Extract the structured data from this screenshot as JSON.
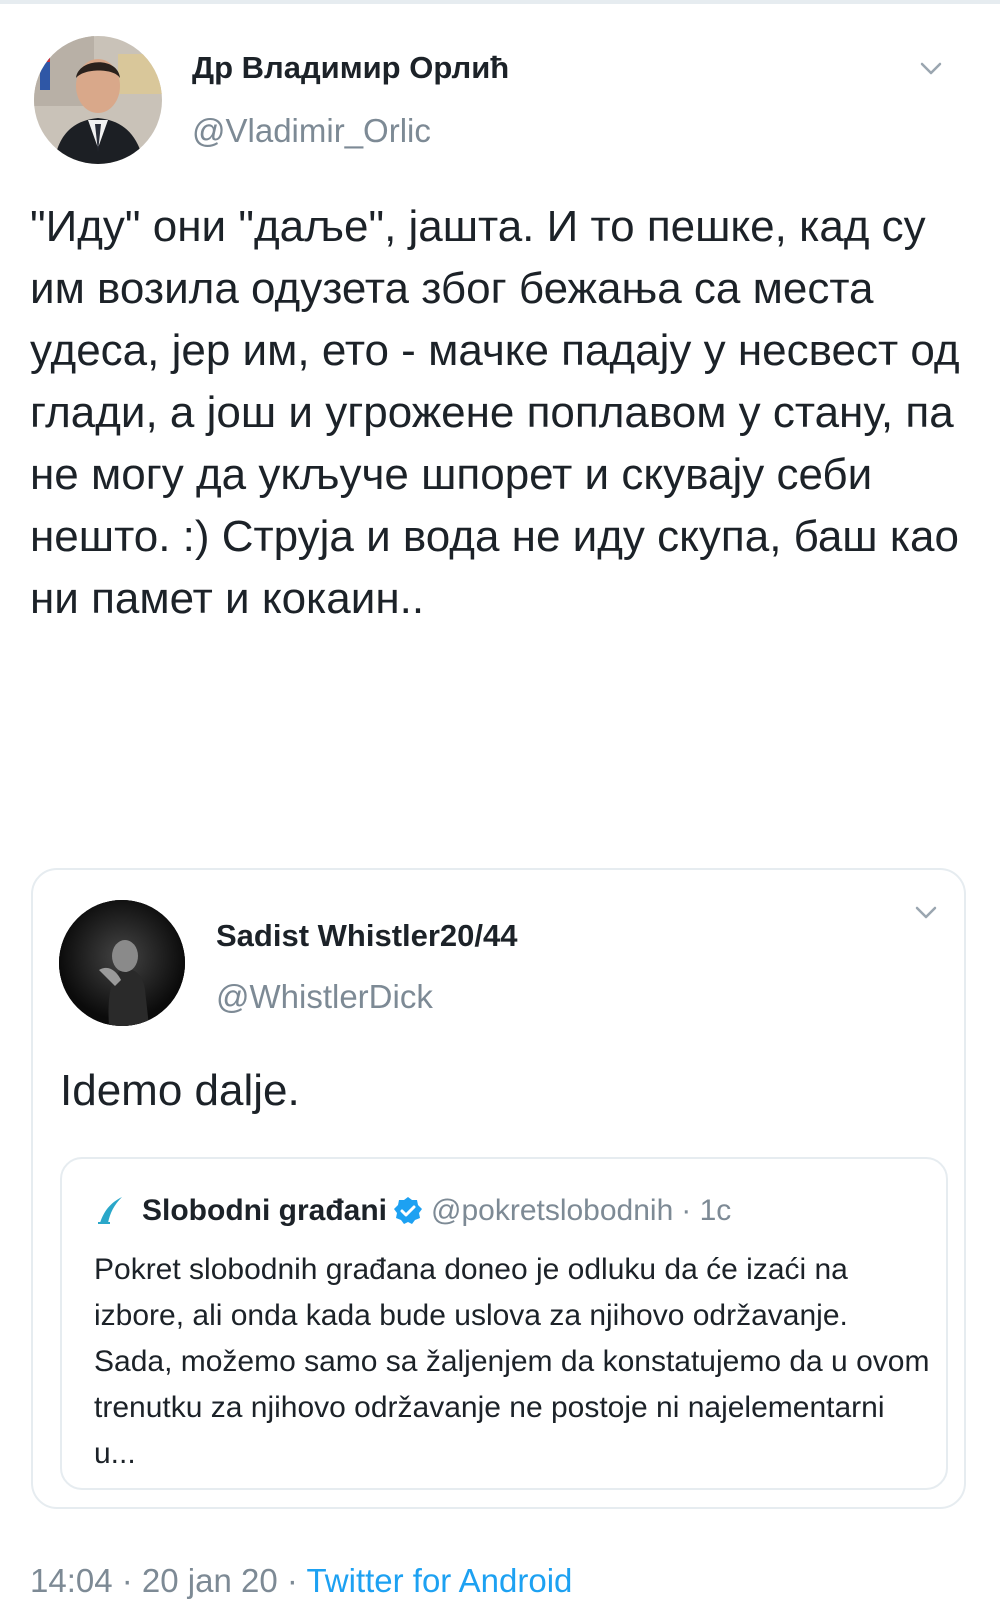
{
  "main_tweet": {
    "display_name": "Др Владимир Орлић",
    "handle": "@Vladimir_Orlic",
    "text": "\"Иду\" они \"даље\", јашта. И то пешке, кад су им возила одузета због бежања са места удеса, јер им, ето - мачке падају у несвест од глади, а још и угрожене поплавом у стану, па не могу да укључе шпорет и скувају себи нешто. :) Струја и вода не иду скупа, баш као ни памет и кокаин.."
  },
  "quoted_tweet": {
    "display_name": "Sadist Whistler20/44",
    "handle": "@WhistlerDick",
    "text": "Idemo dalje."
  },
  "nested_quote": {
    "display_name": "Slobodni građani",
    "handle": "@pokretslobodnih",
    "time": "· 1c",
    "text": "Pokret slobodnih građana doneo je odluku da će izaći na izbore, ali onda kada bude uslova za njihovo održavanje. Sada, možemo samo sa žaljenjem da konstatujemo da u ovom trenutku za njihovo održavanje ne postoje ni najelementarni u..."
  },
  "footer": {
    "timestamp": "14:04 · 20 jan 20 · ",
    "source": "Twitter for Android"
  },
  "colors": {
    "link": "#1da1f2",
    "secondary_text": "#7d8a95",
    "border": "#e6ecf0"
  }
}
